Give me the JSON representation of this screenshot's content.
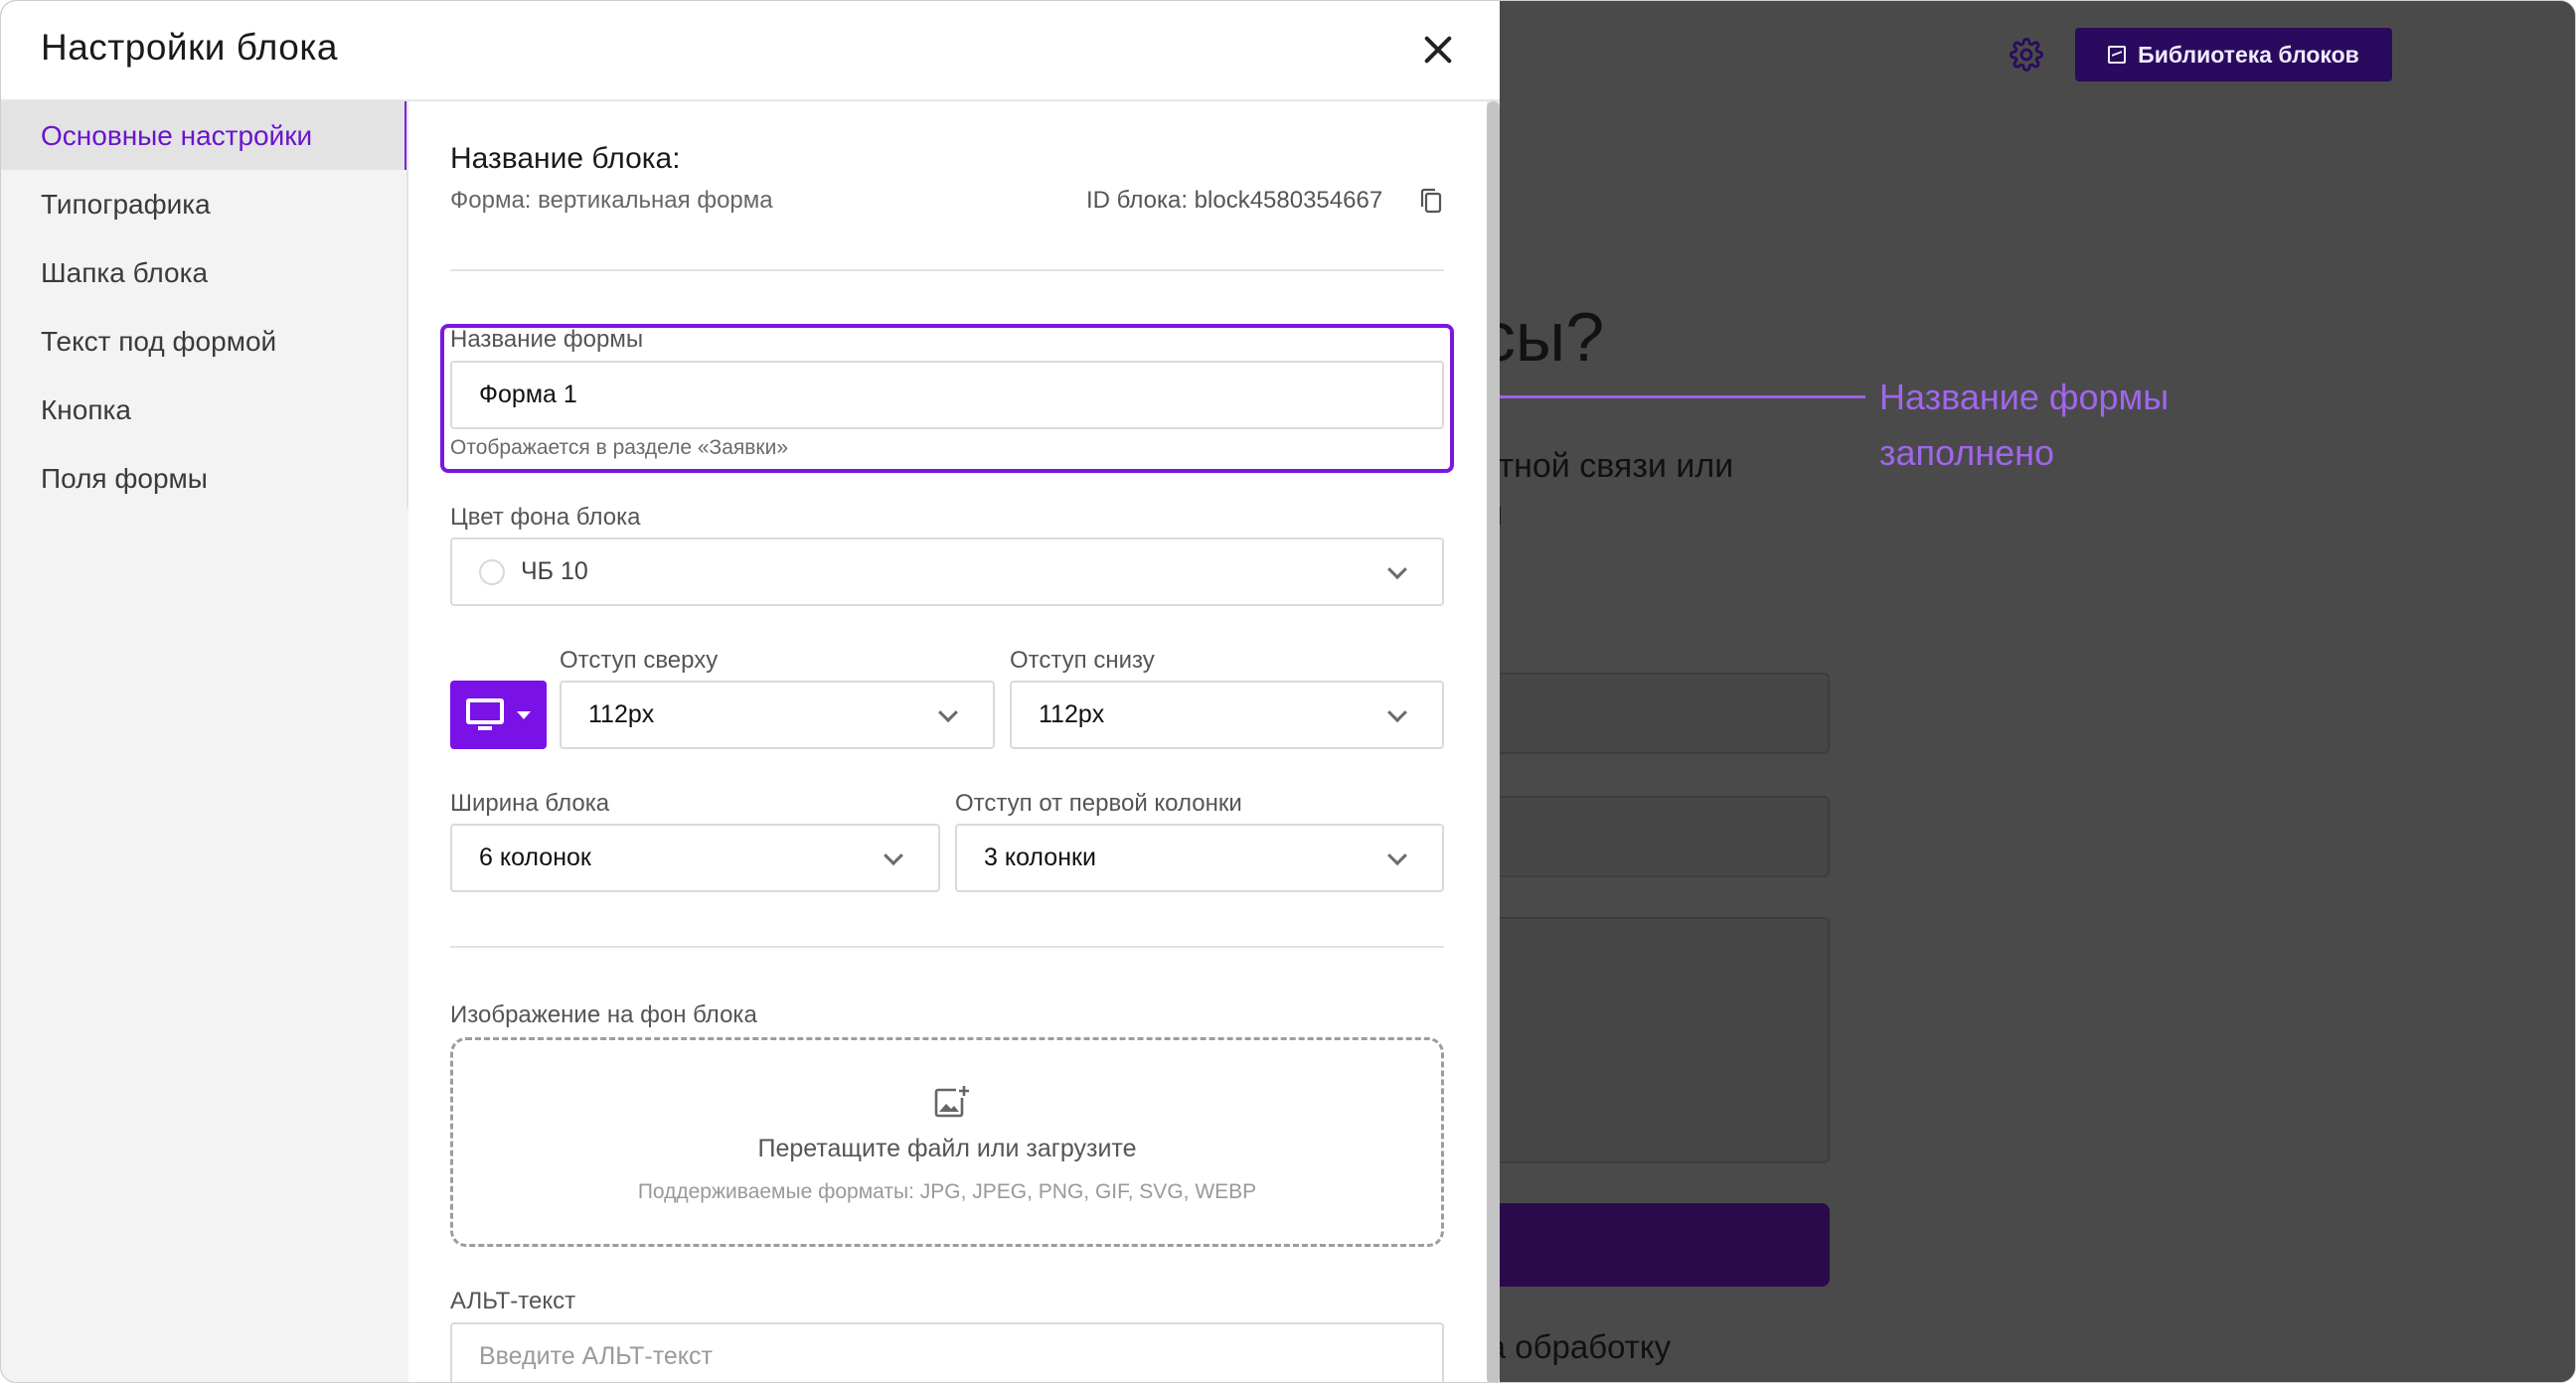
{
  "background_page": {
    "library_button_label": "Библиотека блоков",
    "heading_fragment": "осы?",
    "text_line1": "братной связи или",
    "text_line2": "мой",
    "note_fragment": "е на обработку"
  },
  "annotation": {
    "line1": "Название формы",
    "line2": "заполнено"
  },
  "modal": {
    "title": "Настройки блока",
    "sidebar": [
      {
        "label": "Основные настройки",
        "active": true
      },
      {
        "label": "Типографика"
      },
      {
        "label": "Шапка блока"
      },
      {
        "label": "Текст под формой"
      },
      {
        "label": "Кнопка"
      },
      {
        "label": "Поля формы"
      }
    ],
    "block": {
      "title": "Название блока:",
      "subtitle": "Форма: вертикальная форма",
      "id_label": "ID блока: block4580354667"
    },
    "form_name": {
      "label": "Название формы",
      "value": "Форма 1",
      "hint": "Отображается в разделе «Заявки»"
    },
    "bg_color": {
      "label": "Цвет фона блока",
      "value": "ЧБ 10"
    },
    "padding_top": {
      "label": "Отступ сверху",
      "value": "112px"
    },
    "padding_bottom": {
      "label": "Отступ снизу",
      "value": "112px"
    },
    "block_width": {
      "label": "Ширина блока",
      "value": "6 колонок"
    },
    "first_column_offset": {
      "label": "Отступ от первой колонки",
      "value": "3 колонки"
    },
    "bg_image": {
      "label": "Изображение на фон блока",
      "drop_text": "Перетащите файл или загрузите",
      "formats": "Поддерживаемые форматы: JPG, JPEG, PNG, GIF, SVG, WEBP"
    },
    "alt_text": {
      "label": "АЛЬТ-текст",
      "placeholder": "Введите АЛЬТ-текст"
    }
  }
}
